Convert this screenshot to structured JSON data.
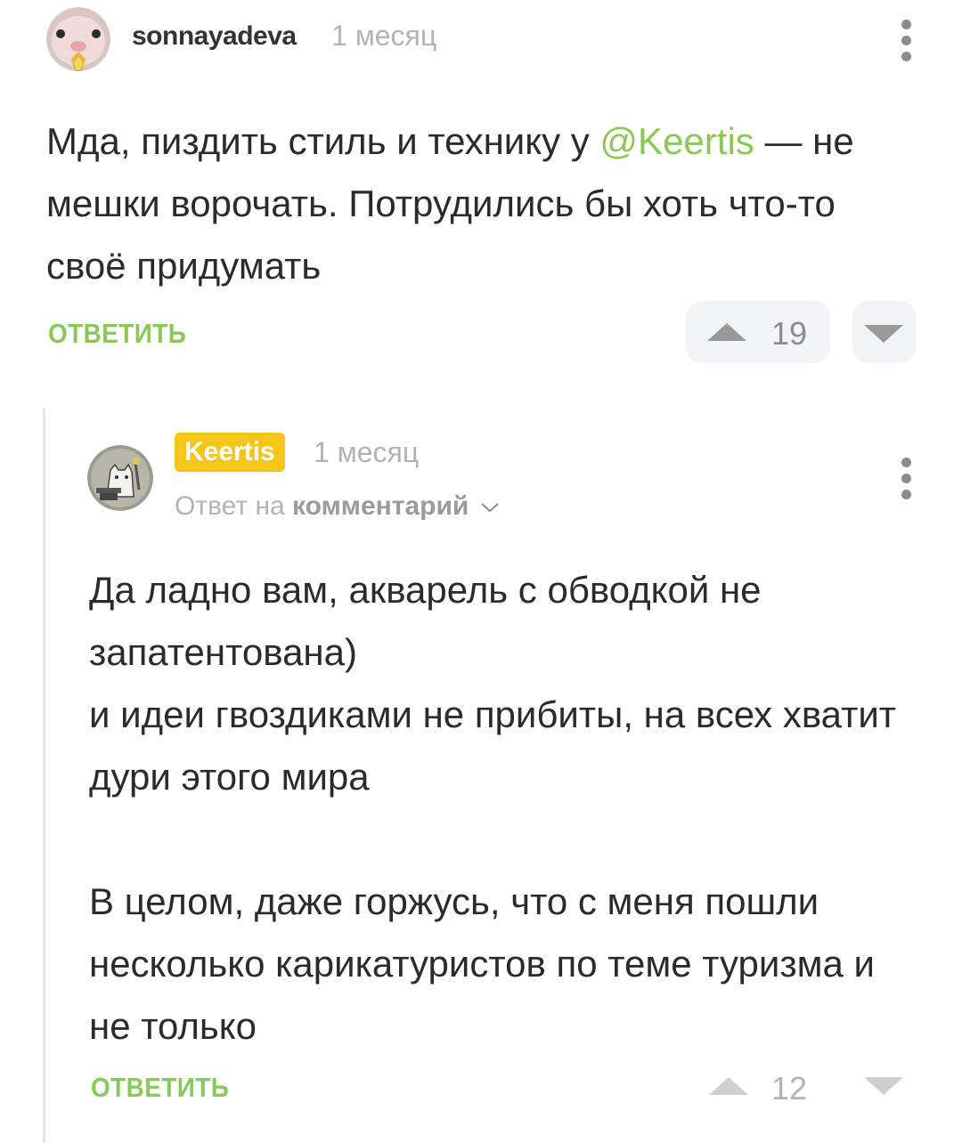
{
  "comment1": {
    "author": "sonnayadeva",
    "time": "1 месяц",
    "text_before": "Мда, пиздить стиль и технику у ",
    "mention": "@Keertis",
    "text_after": " — не мешки ворочать. Потрудились бы хоть что-то своё придумать",
    "reply_label": "ОТВЕТИТЬ",
    "score": "19",
    "avatar_icon": "hamster-avatar",
    "menu_icon": "more-vertical-icon"
  },
  "comment2": {
    "author": "Keertis",
    "time": "1 месяц",
    "reply_to_prefix": "Ответ на",
    "reply_to_link": "комментарий",
    "paragraph1_line1": "Да ладно вам, акварель с обводкой не запатентована)",
    "paragraph1_line2": "и идеи гвоздиками не прибиты, на всех хватит дури этого мира",
    "paragraph2": "В целом, даже горжусь, что с меня пошли несколько карикатуристов по теме туризма и не только",
    "reply_label": "ОТВЕТИТЬ",
    "score": "12",
    "avatar_icon": "cat-blacksmith-avatar",
    "menu_icon": "more-vertical-icon"
  },
  "colors": {
    "accent_green": "#8ac858",
    "author_badge": "#f5c518",
    "muted": "#b3b3b3"
  }
}
